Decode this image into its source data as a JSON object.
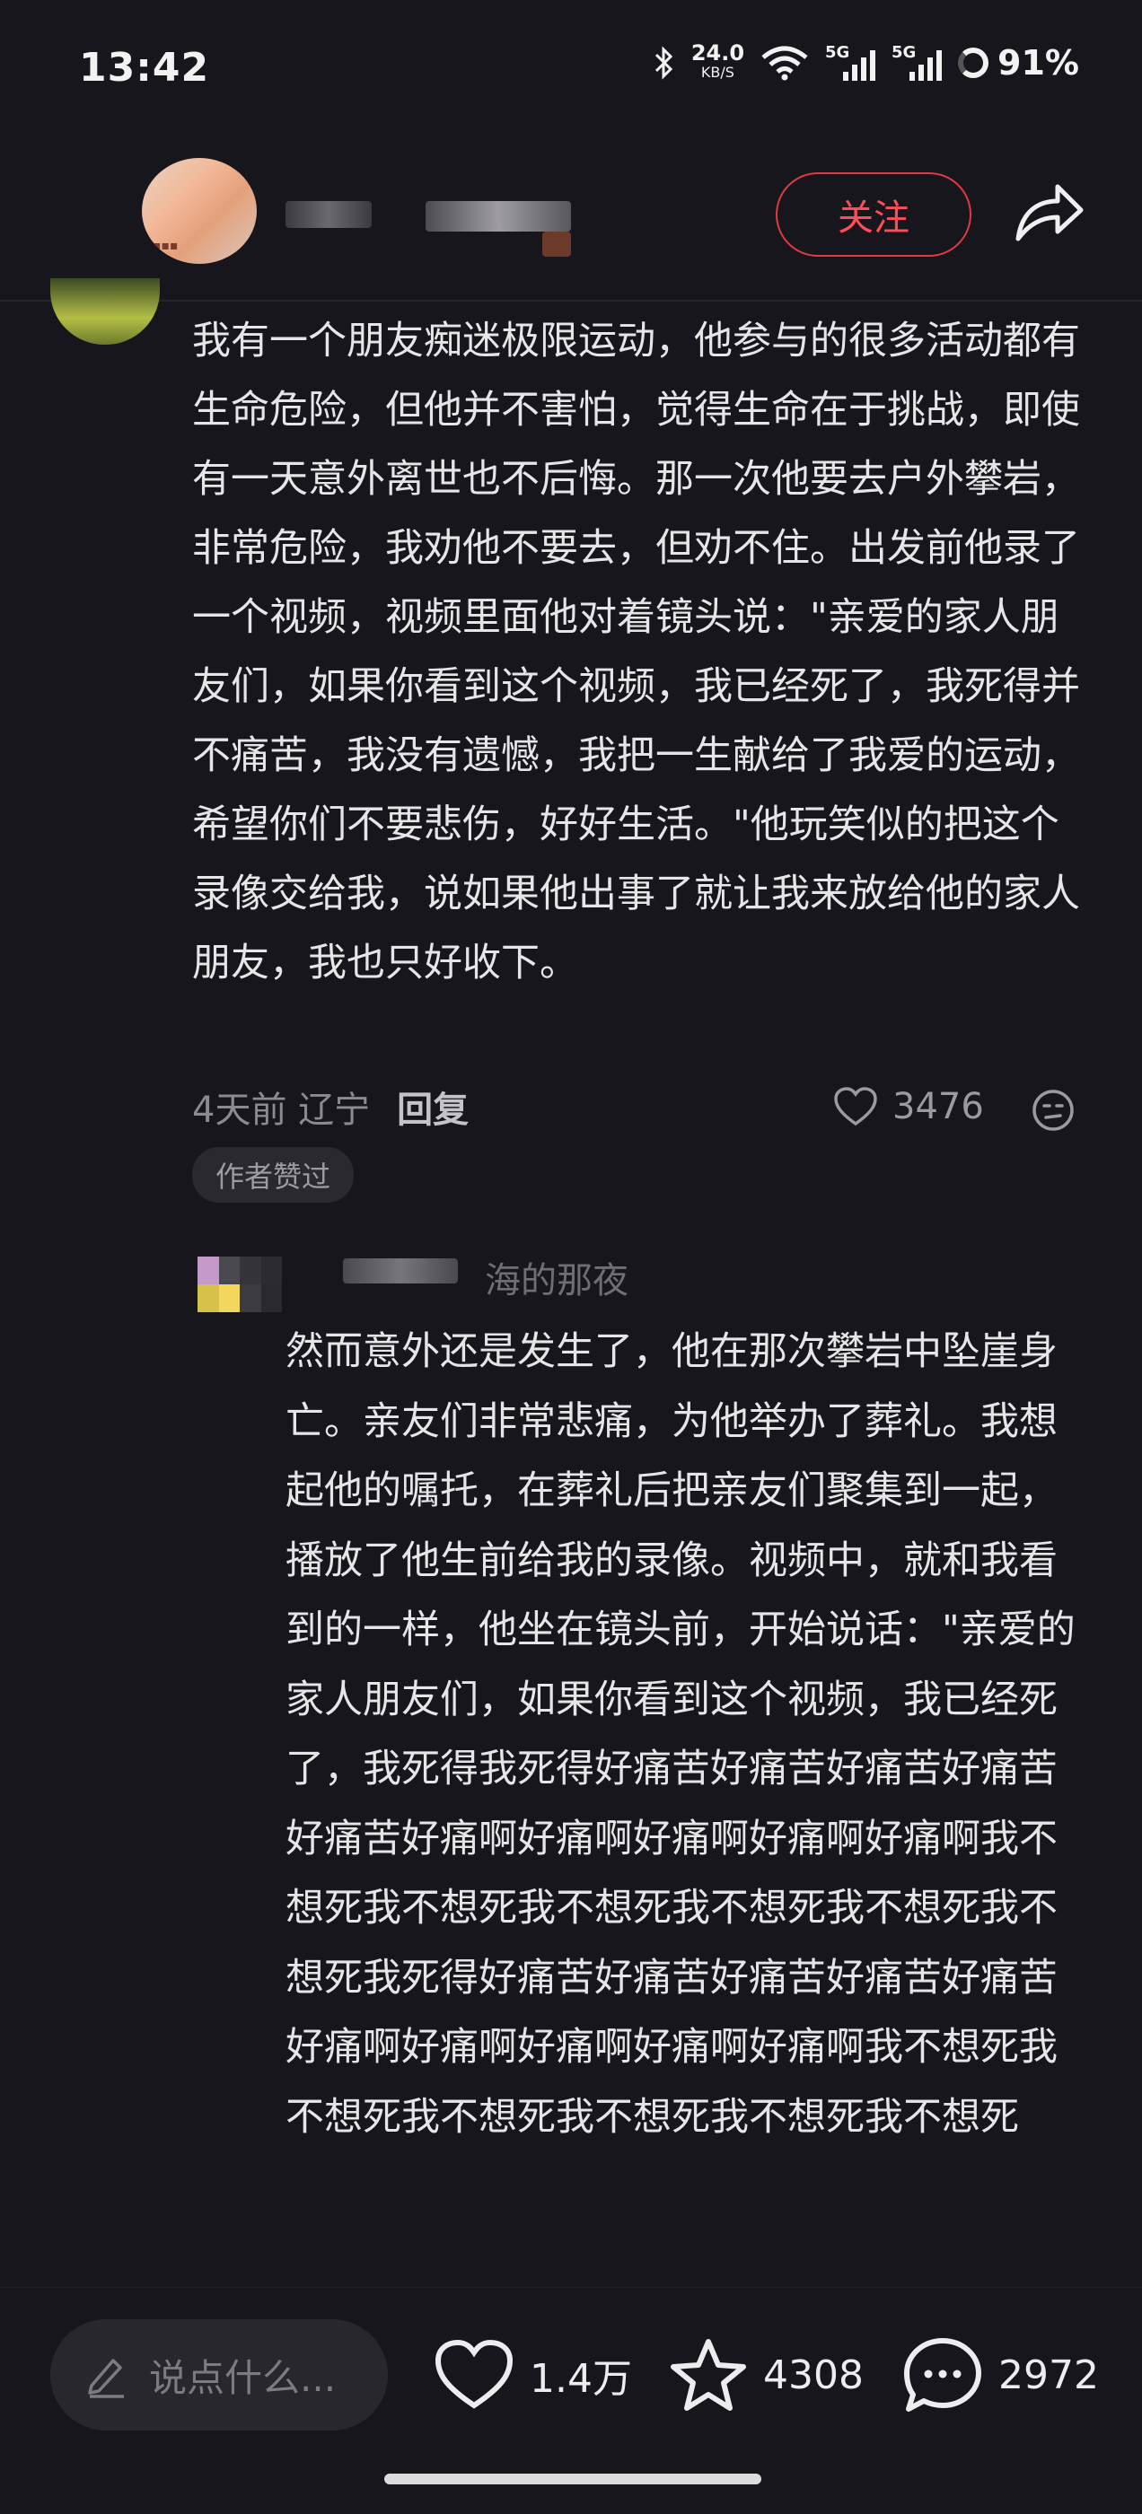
{
  "status_bar": {
    "time": "13:42",
    "net_speed": "24.0",
    "net_unit": "KB/S",
    "signal1": "5G",
    "signal2": "5G",
    "battery": "91%"
  },
  "header": {
    "follow_label": "关注"
  },
  "main_comment": {
    "text": "我有一个朋友痴迷极限运动，他参与的很多活动都有生命危险，但他并不害怕，觉得生命在于挑战，即使有一天意外离世也不后悔。那一次他要去户外攀岩，非常危险，我劝他不要去，但劝不住。出发前他录了一个视频，视频里面他对着镜头说：\"亲爱的家人朋友们，如果你看到这个视频，我已经死了，我死得并不痛苦，我没有遗憾，我把一生献给了我爱的运动，希望你们不要悲伤，好好生活。\"他玩笑似的把这个录像交给我，说如果他出事了就让我来放给他的家人朋友，我也只好收下。",
    "time_location": "4天前 辽宁",
    "reply_label": "回复",
    "likes": "3476",
    "author_badge": "作者赞过"
  },
  "reply": {
    "name_partial": "海的那夜",
    "text": "然而意外还是发生了，他在那次攀岩中坠崖身亡。亲友们非常悲痛，为他举办了葬礼。我想起他的嘱托，在葬礼后把亲友们聚集到一起，播放了他生前给我的录像。视频中，就和我看到的一样，他坐在镜头前，开始说话：\"亲爱的家人朋友们，如果你看到这个视频，我已经死了，我死得我死得好痛苦好痛苦好痛苦好痛苦好痛苦好痛啊好痛啊好痛啊好痛啊好痛啊我不想死我不想死我不想死我不想死我不想死我不想死我死得好痛苦好痛苦好痛苦好痛苦好痛苦好痛啊好痛啊好痛啊好痛啊好痛啊我不想死我不想死我不想死我不想死我不想死我不想死"
  },
  "bottom_bar": {
    "input_placeholder": "说点什么...",
    "likes": "1.4万",
    "favorites": "4308",
    "comments": "2972"
  },
  "colors": {
    "background": "#17161c",
    "accent": "#ff4c5a"
  },
  "icons": [
    "bluetooth-icon",
    "wifi-icon",
    "share-icon",
    "heart-icon",
    "face-icon",
    "pencil-icon",
    "star-icon",
    "chat-icon"
  ]
}
